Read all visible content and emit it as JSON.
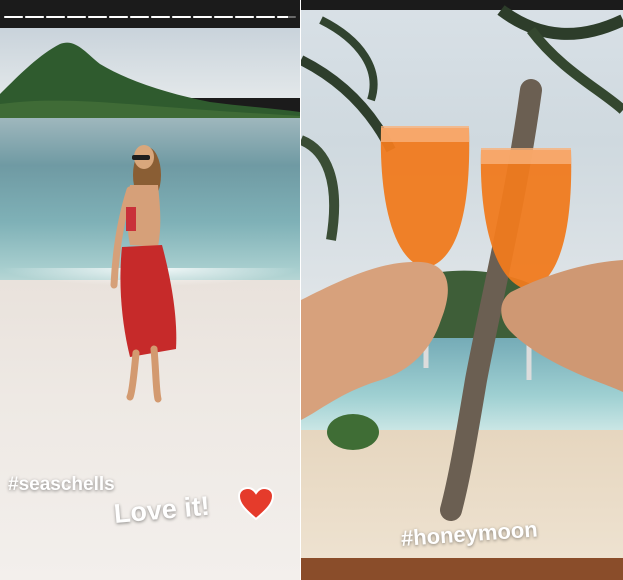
{
  "stories": [
    {
      "id": "left",
      "hashtag": "#seaschells",
      "caption": "Love it!",
      "heart_color": "#e53b2b",
      "progress_segments": [
        1,
        1,
        1,
        1,
        1,
        1,
        1,
        1,
        1,
        1,
        1,
        1,
        1,
        0.6
      ]
    },
    {
      "id": "right",
      "hashtag": "#honeymoon",
      "progress_segments": []
    }
  ]
}
